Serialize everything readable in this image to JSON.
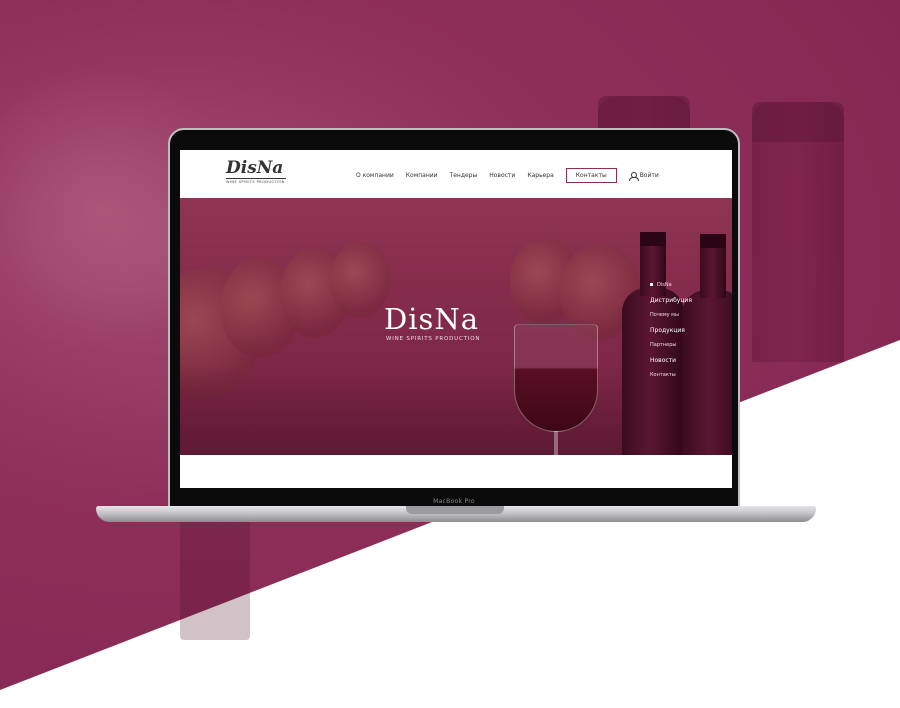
{
  "site": {
    "logo": {
      "wordmark": "DisNa",
      "tagline": "WINE SPIRITS PRODUCTION"
    },
    "nav": [
      {
        "label": "О компании"
      },
      {
        "label": "Компании"
      },
      {
        "label": "Тендеры"
      },
      {
        "label": "Новости"
      },
      {
        "label": "Карьера"
      }
    ],
    "contact_button": "Контакты",
    "login_label": "Войти",
    "hero": {
      "title": "DisNa",
      "subtitle": "WINE SPIRITS PRODUCTION"
    },
    "side_menu": [
      {
        "label": "DisNa",
        "active": true
      },
      {
        "label": "Дистрибуция"
      },
      {
        "label": "Почему мы"
      },
      {
        "label": "Продукция"
      },
      {
        "label": "Партнеры"
      },
      {
        "label": "Новости"
      },
      {
        "label": "Контакты"
      }
    ]
  },
  "device": {
    "label": "MacBook Pro"
  },
  "colors": {
    "brand": "#8e2f59",
    "background_accent": "#8a2c57",
    "text": "#333333"
  },
  "icons": {
    "login": "user-icon"
  }
}
